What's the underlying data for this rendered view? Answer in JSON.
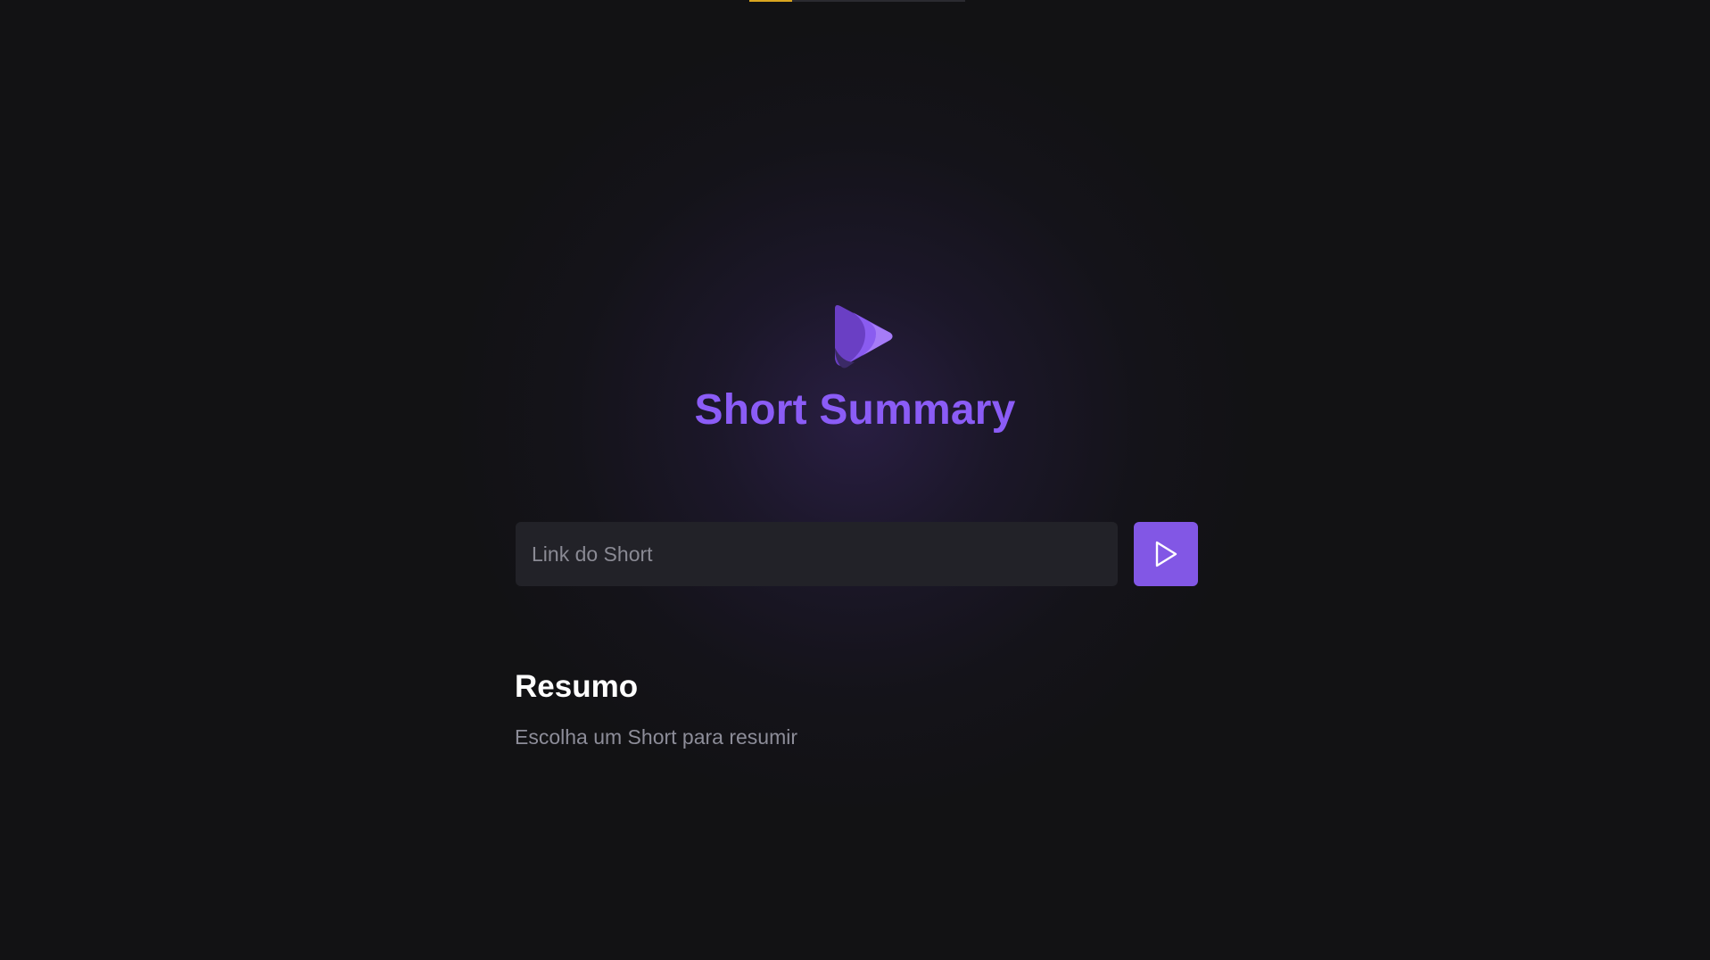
{
  "app": {
    "title": "Short Summary",
    "logo_icon": "play-logo-icon"
  },
  "search": {
    "placeholder": "Link do Short",
    "value": "",
    "submit_icon": "play-icon"
  },
  "summary": {
    "heading": "Resumo",
    "text": "Escolha um Short para resumir"
  },
  "colors": {
    "background": "#121214",
    "accent": "#8257e5",
    "title": "#8b5cf6",
    "input_background": "#222228",
    "muted_text": "#8d8d99",
    "top_accent": "#d9a520"
  }
}
